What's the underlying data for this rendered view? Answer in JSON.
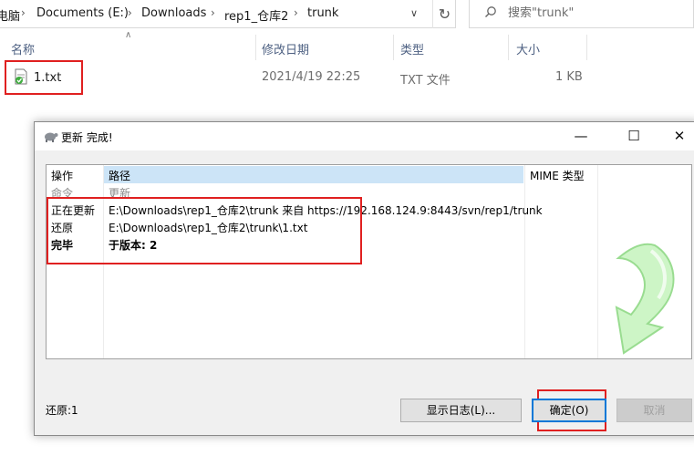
{
  "explorer": {
    "breadcrumb": [
      "电脑",
      "Documents (E:)",
      "Downloads",
      "rep1_仓库2",
      "trunk"
    ],
    "search_placeholder": "搜索\"trunk\"",
    "columns": [
      "名称",
      "修改日期",
      "类型",
      "大小"
    ],
    "file": {
      "name": "1.txt",
      "modified": "2021/4/19 22:25",
      "type": "TXT 文件",
      "size": "1 KB"
    },
    "icons": [
      "chevron-right-icon",
      "chevron-down-icon",
      "refresh-icon",
      "search-icon",
      "sort-up-icon",
      "text-file-icon"
    ]
  },
  "dialog": {
    "title": "更新 完成!",
    "window_buttons": {
      "minimize": "—",
      "maximize": "☐",
      "close": "✕"
    },
    "log": {
      "headers": {
        "action": "操作",
        "path": "路径",
        "mime": "MIME 类型"
      },
      "rows": [
        {
          "action": "命令",
          "path": "更新",
          "style": "gray"
        },
        {
          "action": "正在更新",
          "path": "E:\\Downloads\\rep1_仓库2\\trunk 来自 https://192.168.124.9:8443/svn/rep1/trunk",
          "style": "normal"
        },
        {
          "action": "还原",
          "path": "E:\\Downloads\\rep1_仓库2\\trunk\\1.txt",
          "style": "normal"
        },
        {
          "action": "完毕",
          "path": "于版本: 2",
          "style": "bold"
        }
      ]
    },
    "status": "还原:1",
    "buttons": {
      "show_log": "显示日志(L)...",
      "ok": "确定(O)",
      "cancel": "取消"
    },
    "colors": {
      "highlight_red": "#e02020",
      "selection_blue": "#cce4f7",
      "arrow_green": "#b9f0b0"
    }
  }
}
